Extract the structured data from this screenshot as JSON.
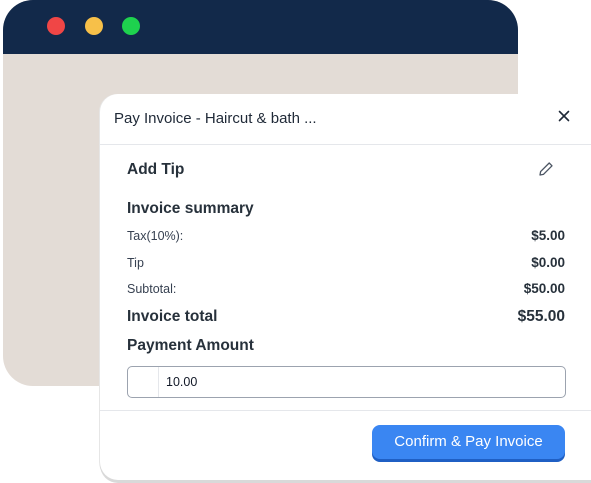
{
  "modal": {
    "title": "Pay Invoice - Haircut & bath ...",
    "add_tip_label": "Add Tip",
    "summary_title": "Invoice summary",
    "rows": [
      {
        "label": "Tax(10%):",
        "value": "$5.00"
      },
      {
        "label": "Tip",
        "value": "$0.00"
      },
      {
        "label": "Subtotal:",
        "value": "$50.00"
      }
    ],
    "total": {
      "label": "Invoice total",
      "value": "$55.00"
    },
    "payment_amount_label": "Payment Amount",
    "payment_amount_value": "10.00",
    "confirm_label": "Confirm & Pay Invoice"
  },
  "icons": {
    "close": "close-icon",
    "edit": "pencil-icon"
  },
  "colors": {
    "titlebar": "#12294a",
    "window_bg": "#e3dcd6",
    "dot_red": "#f04646",
    "dot_yellow": "#f7c049",
    "dot_green": "#1ed24e",
    "primary": "#3a86f2"
  }
}
